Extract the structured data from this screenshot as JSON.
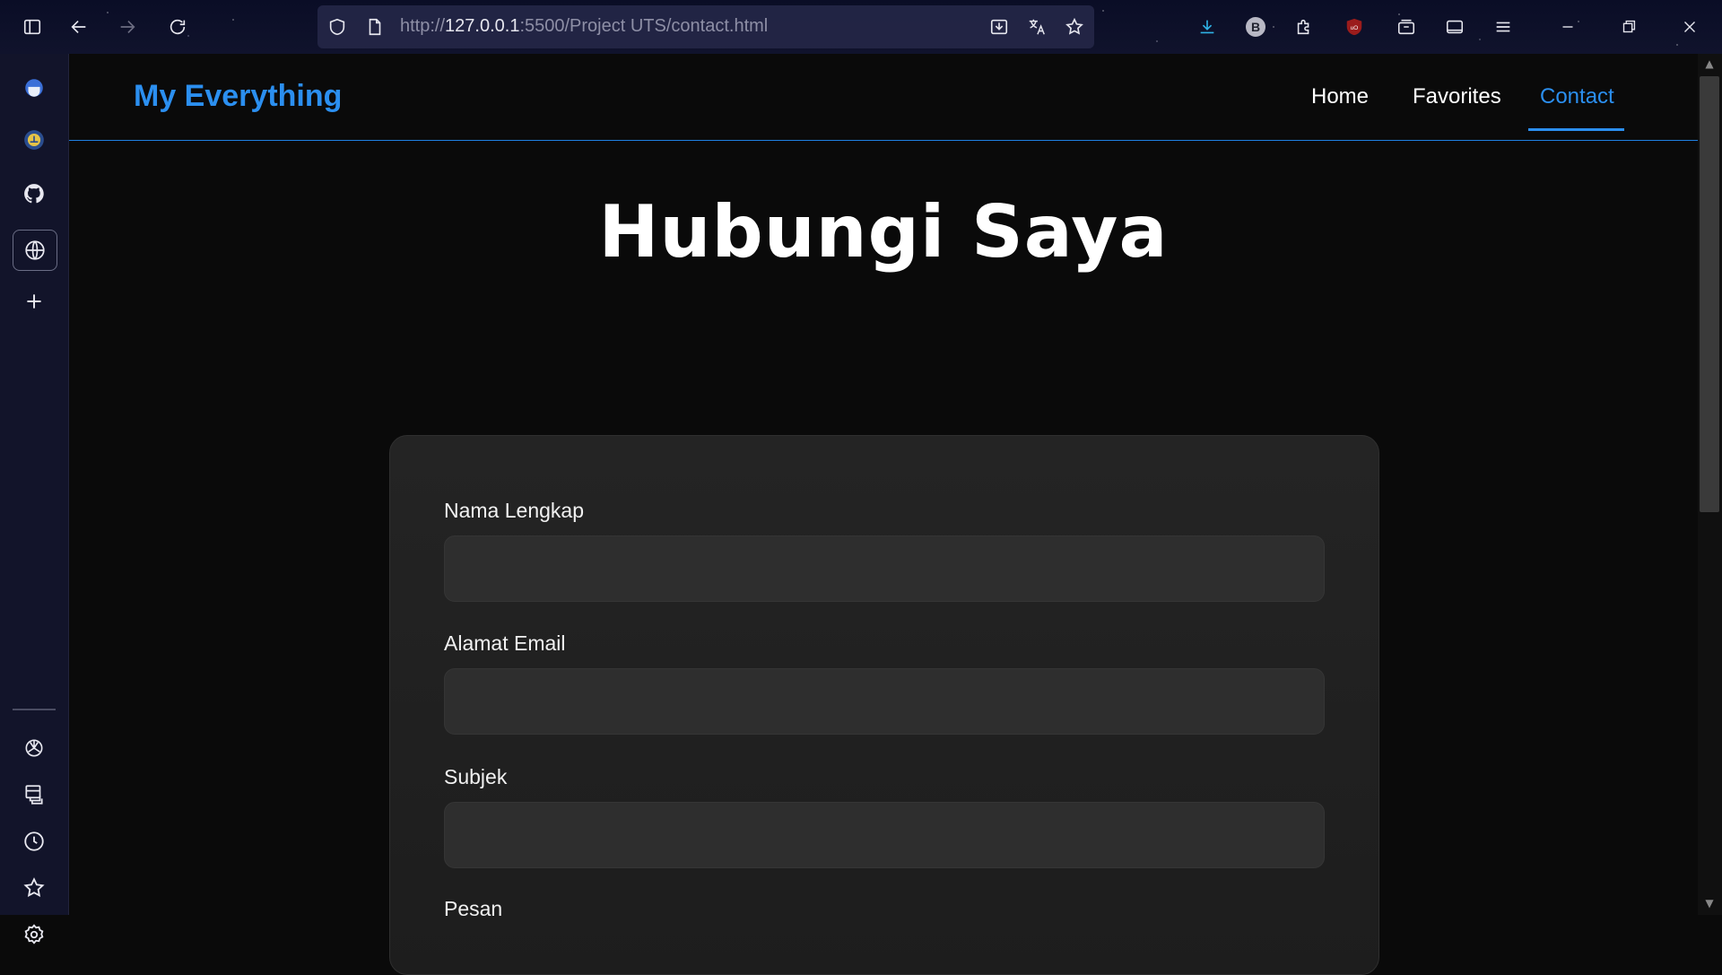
{
  "browser": {
    "url_prefix": "http://",
    "url_host": "127.0.0.1",
    "url_rest": ":5500/Project UTS/contact.html",
    "extension_badge": "B"
  },
  "sidebar": {
    "icons": [
      "app-icon",
      "university-icon",
      "github-icon",
      "globe-icon",
      "plus-icon",
      "chatgpt-icon",
      "database-icon",
      "history-icon",
      "bookmark-star-icon",
      "settings-icon"
    ]
  },
  "site": {
    "brand": "My Everything",
    "nav": [
      {
        "label": "Home",
        "active": false
      },
      {
        "label": "Favorites",
        "active": false
      },
      {
        "label": "Contact",
        "active": true
      }
    ],
    "accent_color": "#2b8ff0"
  },
  "main": {
    "title": "Hubungi Saya",
    "form": {
      "fields": [
        {
          "label": "Nama Lengkap",
          "value": "",
          "placeholder": ""
        },
        {
          "label": "Alamat Email",
          "value": "",
          "placeholder": ""
        },
        {
          "label": "Subjek",
          "value": "",
          "placeholder": ""
        },
        {
          "label": "Pesan",
          "value": "",
          "placeholder": ""
        }
      ]
    }
  }
}
